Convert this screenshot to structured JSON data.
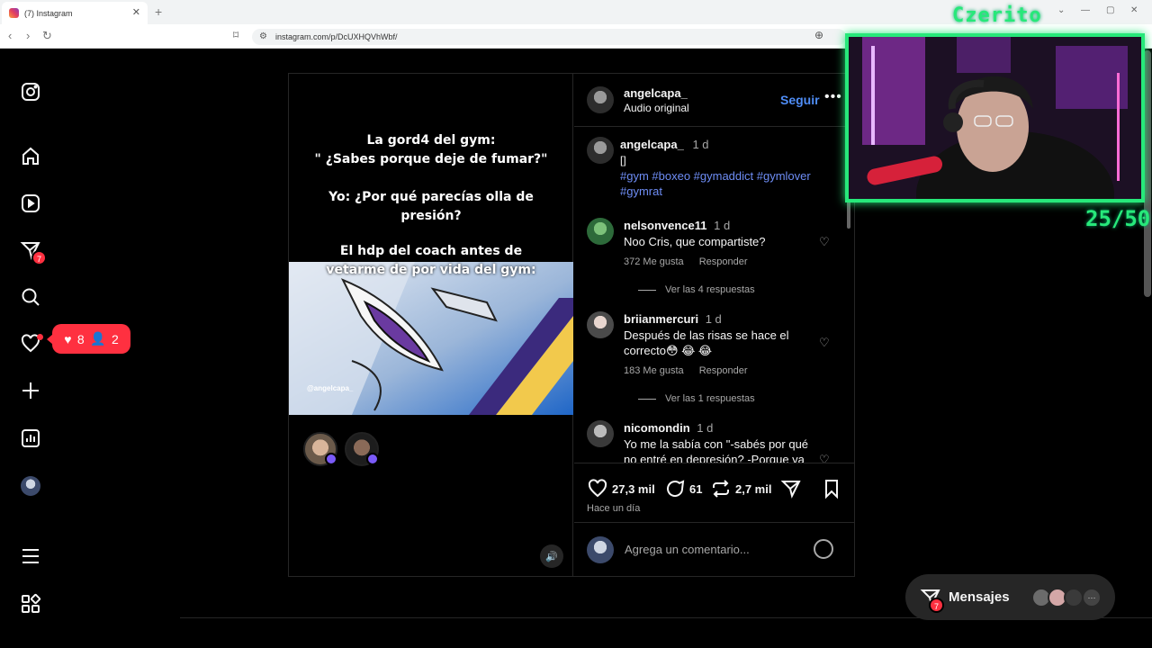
{
  "browser": {
    "tab_title": "(7) Instagram",
    "url": "instagram.com/p/DcUXHQVhWbf/"
  },
  "sidebar": {
    "messages_badge": "7",
    "activity_popup": {
      "likes": "8",
      "follows": "2"
    }
  },
  "post": {
    "author": "angelcapa_",
    "audio": "Audio original",
    "follow_label": "Seguir",
    "media": {
      "caption_top": "La gord4 del gym:\n\" ¿Sabes porque deje de fumar?\"\n\nYo: ¿Por qué parecías olla de\npresión?",
      "caption_bottom": "El hdp del coach antes de\nvetarme de por vida del gym:",
      "watermark": "@angelcapa_"
    },
    "caption": {
      "user": "angelcapa_",
      "time": "1 d",
      "text": "[]",
      "hashtags": "#gym #boxeo #gymaddict #gymlover #gymrat"
    },
    "comments": [
      {
        "user": "nelsonvence11",
        "time": "1 d",
        "text": "Noo Cris, que compartiste?",
        "likes": "372 Me gusta",
        "reply": "Responder",
        "view_replies": "Ver las 4 respuestas"
      },
      {
        "user": "briianmercuri",
        "time": "1 d",
        "text": "Después de las risas se hace el correcto😳 😂 😂",
        "likes": "183 Me gusta",
        "reply": "Responder",
        "view_replies": "Ver las 1 respuestas"
      },
      {
        "user": "nicomondin",
        "time": "1 d",
        "text": "Yo me la sabía con \"-sabés por qué no entré en depresión? -Porque ya"
      }
    ],
    "stats": {
      "likes": "27,3 mil",
      "comments": "61",
      "reposts": "2,7 mil"
    },
    "posted_ago": "Hace un día",
    "comment_placeholder": "Agrega un comentario..."
  },
  "messages": {
    "label": "Mensajes",
    "badge": "7",
    "more": "···"
  },
  "overlay": {
    "streamer": "Czerito",
    "counter": "25/50"
  },
  "colors": {
    "accent_blue": "#4f8df6",
    "notif_red": "#ff3040",
    "overlay_green": "#27e87a"
  }
}
